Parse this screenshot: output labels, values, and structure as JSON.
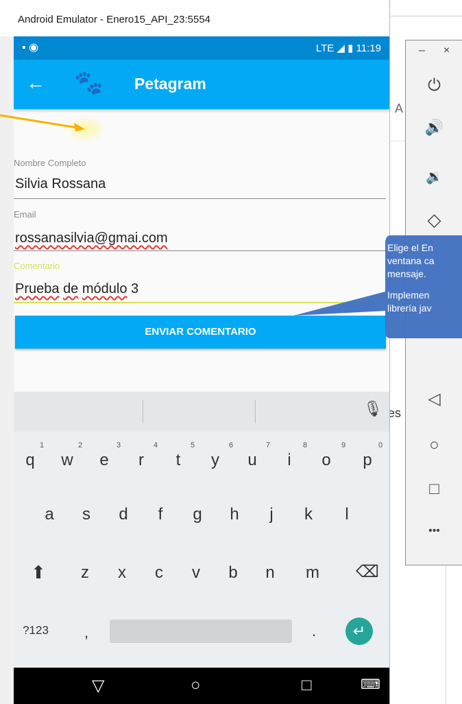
{
  "window": {
    "title": "Android Emulator - Enero15_API_23:5554"
  },
  "status_bar": {
    "left": "▪ ◉",
    "signal": "LTE ◢",
    "time": "11:19"
  },
  "app_bar": {
    "back": "←",
    "title": "Petagram"
  },
  "form": {
    "name_label": "Nombre Completo",
    "name_value": "Silvia Rossana",
    "email_label": "Email",
    "email_value": "rossanasilvia@gmai.com",
    "comment_label": "Comentario",
    "comment_value_1": "Prueba",
    "comment_value_2": "de",
    "comment_value_3": "módulo",
    "comment_value_4": "3",
    "submit_label": "ENVIAR COMENTARIO"
  },
  "keyboard": {
    "row1": [
      "q",
      "w",
      "e",
      "r",
      "t",
      "y",
      "u",
      "i",
      "o",
      "p"
    ],
    "row1_hints": [
      "1",
      "2",
      "3",
      "4",
      "5",
      "6",
      "7",
      "8",
      "9",
      "0"
    ],
    "row2": [
      "a",
      "s",
      "d",
      "f",
      "g",
      "h",
      "j",
      "k",
      "l"
    ],
    "row3": [
      "z",
      "x",
      "c",
      "v",
      "b",
      "n",
      "m"
    ],
    "symbols_key": "?123",
    "comma_key": ",",
    "period_key": ".",
    "shift": "⬆",
    "backspace": "⌫",
    "enter": "↵",
    "mic": "🎙"
  },
  "nav_bar": {
    "back": "▽",
    "home": "○",
    "recents": "□",
    "keyboard": "⌨"
  },
  "controls": {
    "minimize": "–",
    "close": "×",
    "power": "⏻",
    "vol_up": "🔊",
    "vol_down": "🔉",
    "rotate": "◇",
    "back": "◁",
    "home": "○",
    "overview": "□",
    "more": "•••"
  },
  "callout": {
    "line1": "Elige el En",
    "line2": "ventana ca",
    "line3": "mensaje.",
    "line4": "Implemen",
    "line5": "librería jav"
  },
  "background": {
    "letter_a": "A",
    "letters_es": "es"
  },
  "colors": {
    "primary_dark": "#0288d1",
    "primary": "#03a9f4",
    "accent": "#d4e157",
    "callout": "#3f6fbf"
  }
}
